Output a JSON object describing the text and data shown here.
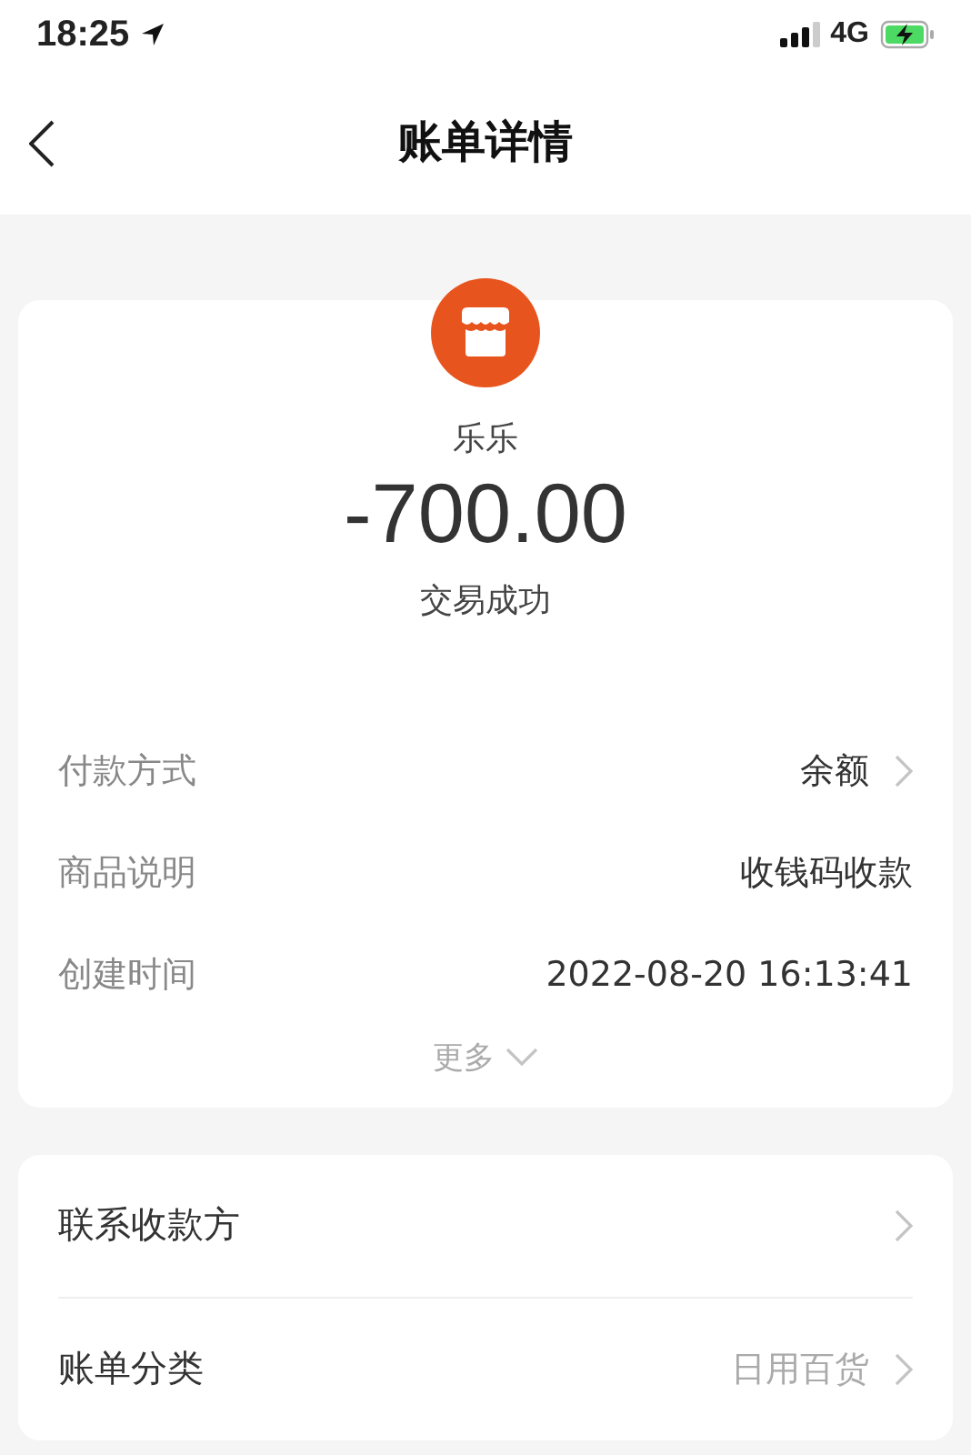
{
  "status_bar": {
    "time": "18:25",
    "network": "4G"
  },
  "nav": {
    "title": "账单详情"
  },
  "summary": {
    "payee": "乐乐",
    "amount": "-700.00",
    "status": "交易成功"
  },
  "details": [
    {
      "label": "付款方式",
      "value": "余额",
      "chevron": true
    },
    {
      "label": "商品说明",
      "value": "收钱码收款",
      "chevron": false
    },
    {
      "label": "创建时间",
      "value": "2022-08-20 16:13:41",
      "chevron": false
    }
  ],
  "more": {
    "label": "更多",
    "expanded": false
  },
  "actions": [
    {
      "label": "联系收款方",
      "chevron": true
    },
    {
      "label": "账单分类",
      "value": "日用百货",
      "chevron": true
    }
  ]
}
